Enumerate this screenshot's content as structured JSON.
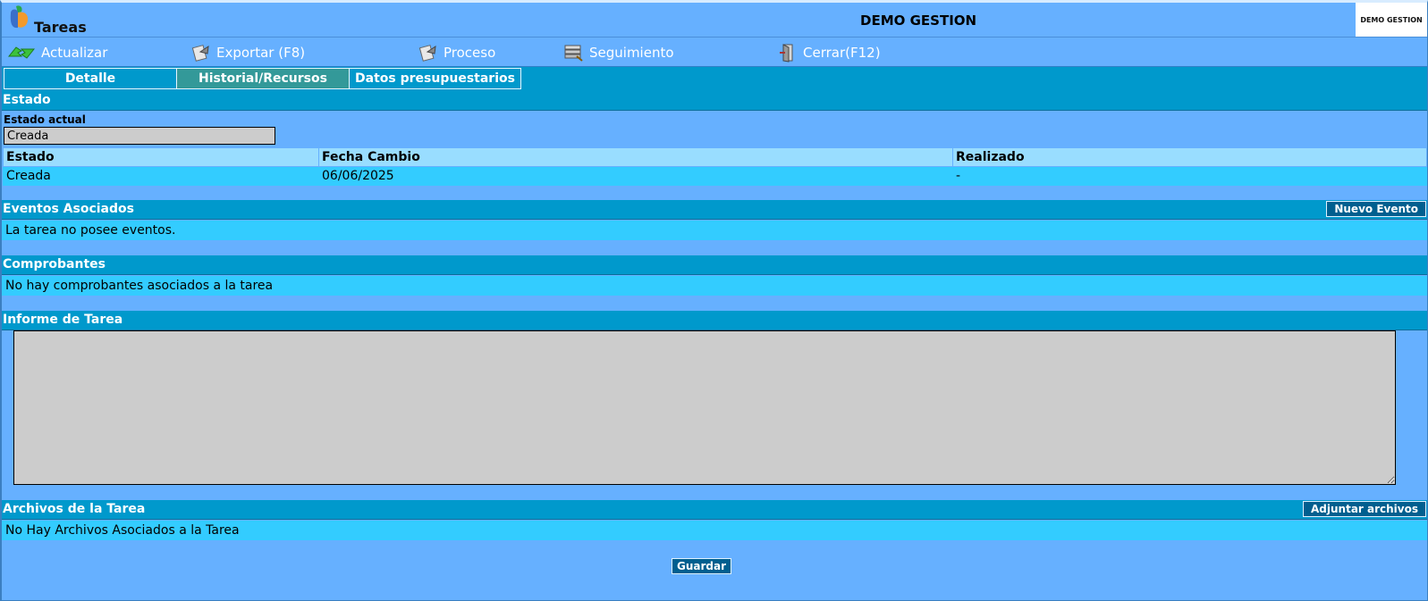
{
  "app": {
    "title": "Tareas",
    "center_title": "DEMO GESTION",
    "brand": "DEMO GESTION"
  },
  "toolbar": {
    "items": [
      {
        "label": "Actualizar",
        "icon": "refresh-icon"
      },
      {
        "label": "Exportar (F8)",
        "icon": "export-icon"
      },
      {
        "label": "Proceso",
        "icon": "process-icon"
      },
      {
        "label": "Seguimiento",
        "icon": "tracking-icon"
      },
      {
        "label": "Cerrar(F12)",
        "icon": "close-icon"
      }
    ]
  },
  "tabs": [
    {
      "label": "Detalle",
      "active": false
    },
    {
      "label": "Historial/Recursos",
      "active": true
    },
    {
      "label": "Datos presupuestarios",
      "active": false
    }
  ],
  "estado": {
    "header": "Estado",
    "current_label": "Estado actual",
    "current_value": "Creada",
    "columns": [
      "Estado",
      "Fecha Cambio",
      "Realizado"
    ],
    "rows": [
      [
        "Creada",
        "06/06/2025",
        "-"
      ]
    ]
  },
  "eventos": {
    "header": "Eventos Asociados",
    "button": "Nuevo Evento",
    "message": "La tarea no posee eventos."
  },
  "comprobantes": {
    "header": "Comprobantes",
    "message": "No hay comprobantes asociados a la tarea"
  },
  "informe": {
    "header": "Informe de Tarea",
    "value": ""
  },
  "archivos": {
    "header": "Archivos de la Tarea",
    "button": "Adjuntar archivos",
    "message": "No Hay Archivos Asociados a la Tarea"
  },
  "actions": {
    "save": "Guardar"
  },
  "colors": {
    "background": "#66b0ff",
    "header": "#0099cc",
    "active_tab": "#339999",
    "row": "#33ccff",
    "table_header": "#99ddff",
    "button": "#005f8f"
  }
}
